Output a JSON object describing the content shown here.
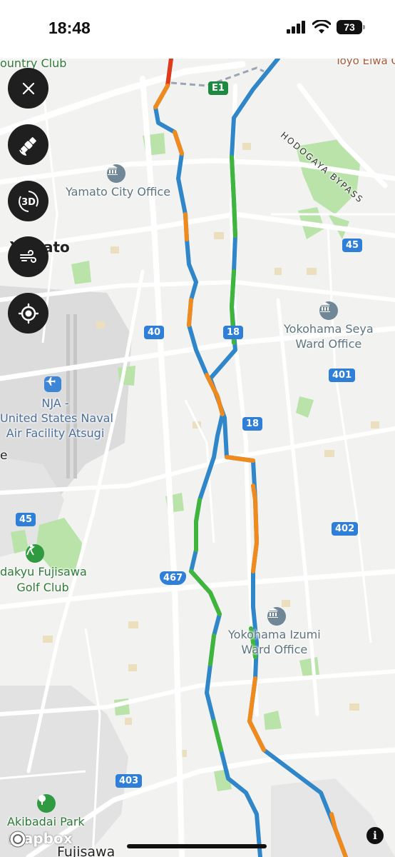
{
  "status_bar": {
    "time": "18:48",
    "battery": "73"
  },
  "map": {
    "labels": {
      "country_club": "ountry Club",
      "toyo": "Toyo Elwa G",
      "hodogaya": "HODOGAYA BYPASS",
      "yamato_office": "Yamato City Office",
      "yamato_city": "Yamato",
      "yokohama_seya_1": "Yokohama Seya",
      "yokohama_seya_2": "Ward Office",
      "nja_1": "NJA -",
      "nja_2": "United States Naval",
      "nja_3": "Air Facility Atsugi",
      "edge_e": "e",
      "golf_1": "dakyu Fujisawa",
      "golf_2": "Golf Club",
      "izumi_1": "Yokohama Izumi",
      "izumi_2": "Ward Office",
      "akibadai": "Akibadai Park",
      "fujisawa": "Fujisawa"
    },
    "highways": {
      "e1": "E1",
      "r45a": "45",
      "r40": "40",
      "r18a": "18",
      "r401": "401",
      "r18b": "18",
      "r45b": "45",
      "r402": "402",
      "r467": "467",
      "r403": "403"
    },
    "attribution": "mapbox",
    "info_glyph": "i"
  },
  "controls": [
    "close-icon",
    "satellite-icon",
    "3d-icon",
    "wind-icon",
    "locate-icon"
  ],
  "controls_text": {
    "three_d": "3D"
  },
  "colors": {
    "route_blue": "#2f86c8",
    "route_green": "#3fb63b",
    "route_orange": "#f08a1c",
    "route_red": "#e03a1a",
    "park_green": "#b9e3a9",
    "road": "#ffffff",
    "control_bg": "#1f1f1f"
  }
}
